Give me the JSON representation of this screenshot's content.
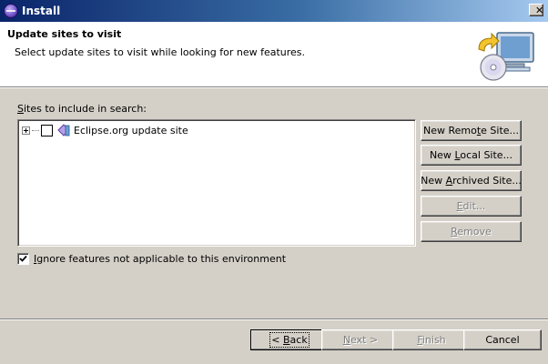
{
  "window": {
    "title": "Install"
  },
  "banner": {
    "title": "Update sites to visit",
    "description": "Select update sites to visit while looking for new features."
  },
  "sites": {
    "label_pre": "",
    "label_accel": "S",
    "label_post": "ites to include in search:",
    "items": [
      {
        "label": "Eclipse.org update site",
        "checked": false,
        "expanded": false
      }
    ]
  },
  "side_buttons": {
    "new_remote": {
      "pre": "New Remo",
      "accel": "t",
      "post": "e Site..."
    },
    "new_local": {
      "pre": "New ",
      "accel": "L",
      "post": "ocal Site..."
    },
    "new_archived": {
      "pre": "New ",
      "accel": "A",
      "post": "rchived Site..."
    },
    "edit": {
      "pre": "",
      "accel": "E",
      "post": "dit..."
    },
    "remove": {
      "pre": "",
      "accel": "R",
      "post": "emove"
    }
  },
  "ignore_option": {
    "pre": "",
    "accel": "I",
    "post": "gnore features not applicable to this environment",
    "checked": true
  },
  "footer_buttons": {
    "back": {
      "pre": "< ",
      "accel": "B",
      "post": "ack"
    },
    "next": {
      "pre": "",
      "accel": "N",
      "post": "ext >"
    },
    "finish": {
      "pre": "",
      "accel": "F",
      "post": "inish"
    },
    "cancel": {
      "pre": "Cancel",
      "accel": "",
      "post": ""
    }
  },
  "icons": {
    "app": "eclipse-icon",
    "close": "close-icon",
    "banner": "install-wizard-icon",
    "site": "update-site-icon",
    "expander": "plus-expander-icon",
    "check": "checkmark-icon"
  }
}
